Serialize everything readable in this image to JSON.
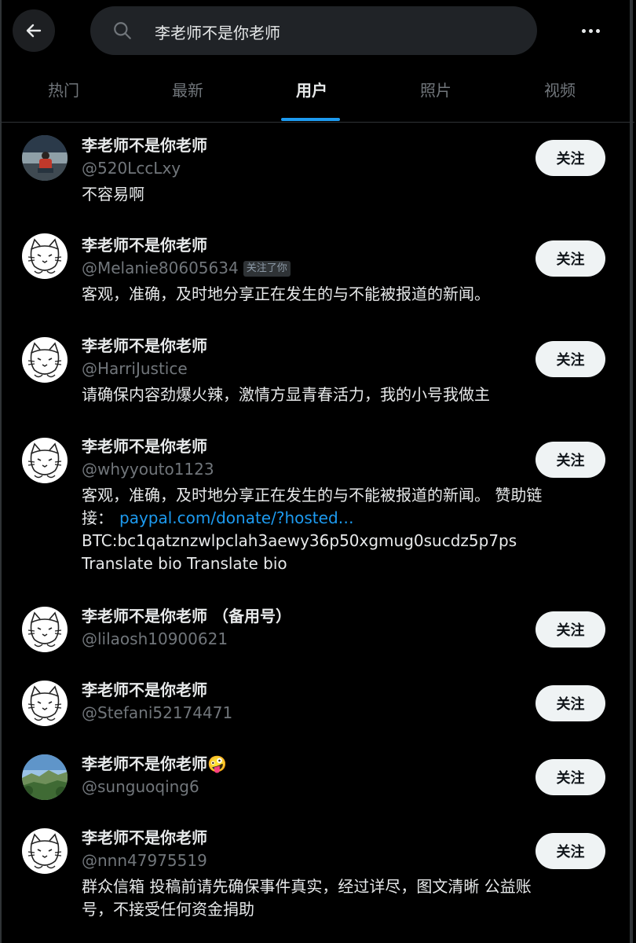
{
  "search": {
    "query": "李老师不是你老师"
  },
  "tabs": [
    {
      "label": "热门"
    },
    {
      "label": "最新"
    },
    {
      "label": "用户"
    },
    {
      "label": "照片"
    },
    {
      "label": "视频"
    }
  ],
  "active_tab": "用户",
  "follow_label": "关注",
  "users": [
    {
      "name": "李老师不是你老师",
      "handle": "@520LccLxy",
      "badge": "",
      "bio": "不容易啊",
      "avatar": "photo-lake"
    },
    {
      "name": "李老师不是你老师",
      "handle": "@Melanie80605634",
      "badge": "关注了你",
      "bio": "客观，准确，及时地分享正在发生的与不能被报道的新闻。",
      "avatar": "cat-sketch"
    },
    {
      "name": "李老师不是你老师",
      "handle": "@HarriJustice",
      "badge": "",
      "bio": "请确保内容劲爆火辣，激情方显青春活力，我的小号我做主",
      "avatar": "cat-sketch"
    },
    {
      "name": "李老师不是你老师",
      "handle": "@whyyouto1123",
      "badge": "",
      "bio_line1": "客观，准确，及时地分享正在发生的与不能被报道的新闻。 赞助链",
      "bio_line2_prefix": "接：",
      "bio_link": "paypal.com/donate/?hosted…",
      "bio_line3": "BTC:bc1qatznzwlpclah3aewy36p50xgmug0sucdz5p7ps",
      "bio_line4": "Translate bio Translate bio",
      "avatar": "cat-sketch"
    },
    {
      "name": "李老师不是你老师 （备用号）",
      "handle": "@lilaosh10900621",
      "badge": "",
      "bio": "",
      "avatar": "cat-sketch"
    },
    {
      "name": "李老师不是你老师",
      "handle": "@Stefani52174471",
      "badge": "",
      "bio": "",
      "avatar": "cat-sketch"
    },
    {
      "name": "李老师不是你老师🤪",
      "handle": "@sunguoqing6",
      "badge": "",
      "bio": "",
      "avatar": "photo-mountain"
    },
    {
      "name": "李老师不是你老师",
      "handle": "@nnn47975519",
      "badge": "",
      "bio_line1": "群众信箱 投稿前请先确保事件真实，经过详尽，图文清晰 公益账",
      "bio_line2": "号，不接受任何资金捐助",
      "avatar": "cat-sketch"
    }
  ]
}
